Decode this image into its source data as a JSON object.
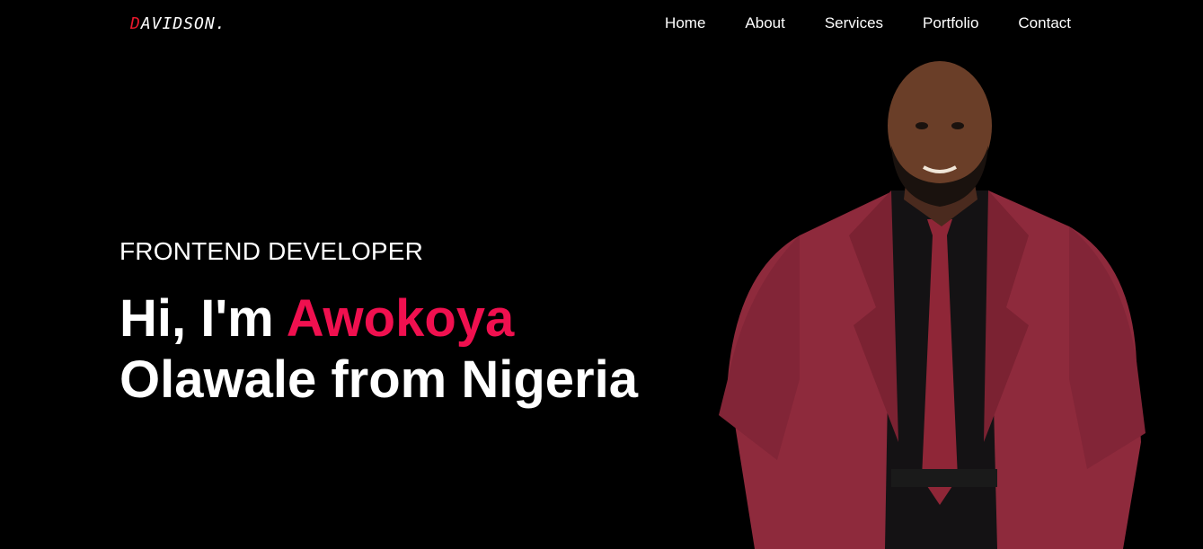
{
  "header": {
    "logo": {
      "first_letter": "D",
      "rest": "AVIDSON."
    },
    "nav": [
      {
        "label": "Home"
      },
      {
        "label": "About"
      },
      {
        "label": "Services"
      },
      {
        "label": "Portfolio"
      },
      {
        "label": "Contact"
      }
    ]
  },
  "hero": {
    "subtitle": "FRONTEND DEVELOPER",
    "greeting": "Hi, I'm",
    "name_highlight": "Awokoya",
    "line2": "Olawale from Nigeria"
  },
  "colors": {
    "background": "#000000",
    "accent": "#f0104f",
    "logo_accent": "#e8182c",
    "suit": "#8e2a3c"
  }
}
